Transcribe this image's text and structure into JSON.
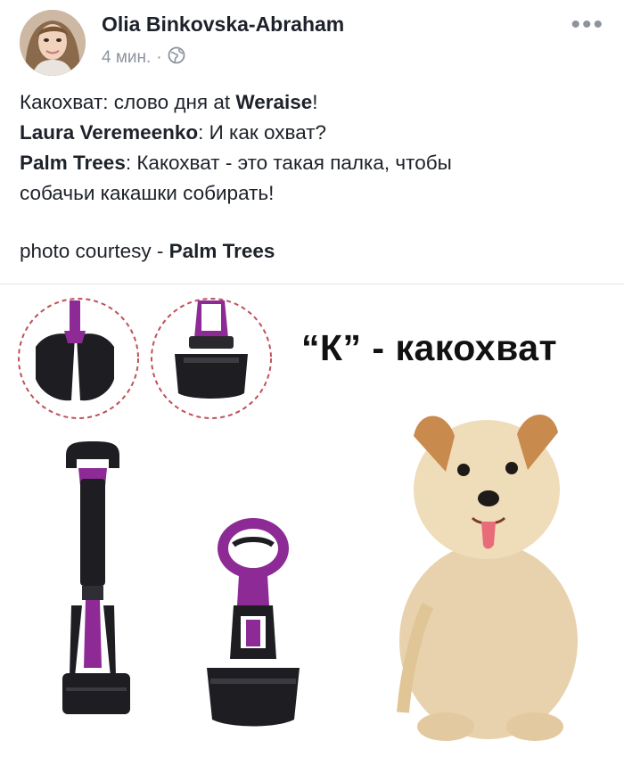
{
  "post": {
    "author": "Olia Binkovska-Abraham",
    "time": "4 мин.",
    "separator": "·",
    "privacy_icon": "globe-icon",
    "more_icon": "more-dots-icon",
    "more_label": "•••"
  },
  "text": {
    "l1_a": "Какохват: слово дня at ",
    "l1_b": "Weraise",
    "l1_c": "!",
    "l2_a": "Laura Veremeenko",
    "l2_b": ": И как охват?",
    "l3_a": "Palm Trees",
    "l3_b": ": Какохват - это такая палка, чтобы",
    "l4": "собачьи какашки собирать!",
    "l5_a": "photo courtesy - ",
    "l5_b": "Palm Trees"
  },
  "photo": {
    "caption": "“К” - какохват"
  },
  "colors": {
    "purple": "#8e2a96",
    "black": "#1e1e22",
    "meta_gray": "#8d949e",
    "dashed_red": "#c0505a"
  }
}
